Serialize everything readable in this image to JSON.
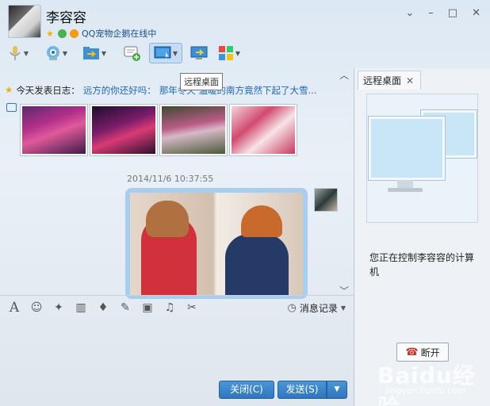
{
  "contact": {
    "name": "李容容",
    "status_text": "QQ宠物企鹅在线中"
  },
  "window_controls": [
    "⌄",
    "–",
    "□",
    "✕"
  ],
  "tooltip": "远程桌面",
  "chat": {
    "blog_prefix": "今天发表日志：",
    "blog_title": "远方的你还好吗：",
    "blog_snippet": "那年冬天 温暖的南方竟然下起了大雪...",
    "timestamp": "2014/11/6 10:37:55"
  },
  "input_toolbar": {
    "history_label": "消息记录"
  },
  "buttons": {
    "close": "关闭(C)",
    "send": "发送(S)"
  },
  "right_panel": {
    "tab_label": "远程桌面",
    "status_text": "您正在控制李容容的计算机",
    "disconnect": "断开"
  },
  "watermark": {
    "main": "Baidu经验",
    "sub": "jingyan.baidu.com"
  }
}
